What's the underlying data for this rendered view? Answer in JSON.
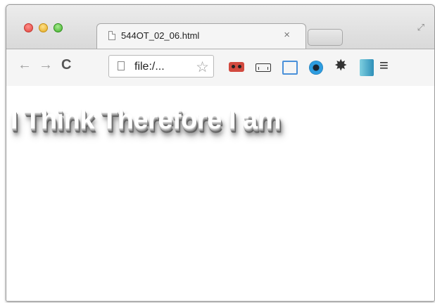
{
  "window": {
    "controls": [
      "close",
      "minimize",
      "maximize"
    ]
  },
  "tab": {
    "title": "544OT_02_06.html",
    "close_glyph": "×",
    "icon": "page-icon"
  },
  "toolbar": {
    "back_glyph": "←",
    "forward_glyph": "→",
    "reload_glyph": "C",
    "address": "file:/...",
    "bookmark_glyph": "☆",
    "menu_glyph": "≡",
    "extensions": [
      "mask-icon",
      "ruler-icon",
      "crop-icon",
      "eye-icon",
      "gear-icon",
      "kitt-icon"
    ]
  },
  "page": {
    "headline": "I Think Therefore I am"
  },
  "colors": {
    "headline_fill": "#ffffff",
    "shadow": "#6e6e6e",
    "toolbar_bg": "#f5f5f5"
  }
}
